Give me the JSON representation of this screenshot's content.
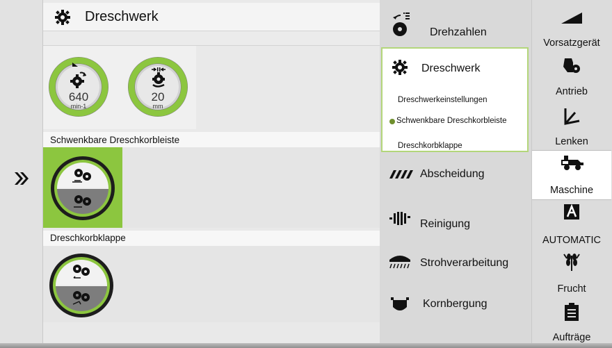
{
  "header": {
    "title": "Dreschwerk"
  },
  "gauges": [
    {
      "value": "640",
      "unit": "min-1",
      "level": 0.72
    },
    {
      "value": "20",
      "unit": "mm",
      "level": 0.35
    }
  ],
  "sections": [
    {
      "label": "Schwenkbare Dreschkorbleiste"
    },
    {
      "label": "Dreschkorbklappe"
    }
  ],
  "nav": {
    "items": [
      {
        "label": "Drehzahlen"
      },
      {
        "label": "Dreschwerk",
        "sub": [
          "Dreschwerkeinstellungen",
          "Schwenkbare Dreschkorbleiste",
          "Dreschkorbklappe"
        ],
        "sub_active_index": 1
      },
      {
        "label": "Abscheidung"
      },
      {
        "label": "Reinigung"
      },
      {
        "label": "Strohverarbeitung"
      },
      {
        "label": "Kornbergung"
      }
    ]
  },
  "menu": {
    "items": [
      {
        "label": "Vorsatzgerät",
        "icon": "header-icon"
      },
      {
        "label": "Antrieb",
        "icon": "drive-icon"
      },
      {
        "label": "Lenken",
        "icon": "steering-icon"
      },
      {
        "label": "Maschine",
        "icon": "combine-icon",
        "active": true
      },
      {
        "label": "AUTOMATIC",
        "icon": "automatic-icon"
      },
      {
        "label": "Frucht",
        "icon": "crop-icon"
      },
      {
        "label": "Aufträge",
        "icon": "clipboard-icon"
      }
    ]
  },
  "colors": {
    "accent": "#8cc63f",
    "selected_border": "#b3d67a",
    "dark_grey": "#7a7a7a"
  }
}
